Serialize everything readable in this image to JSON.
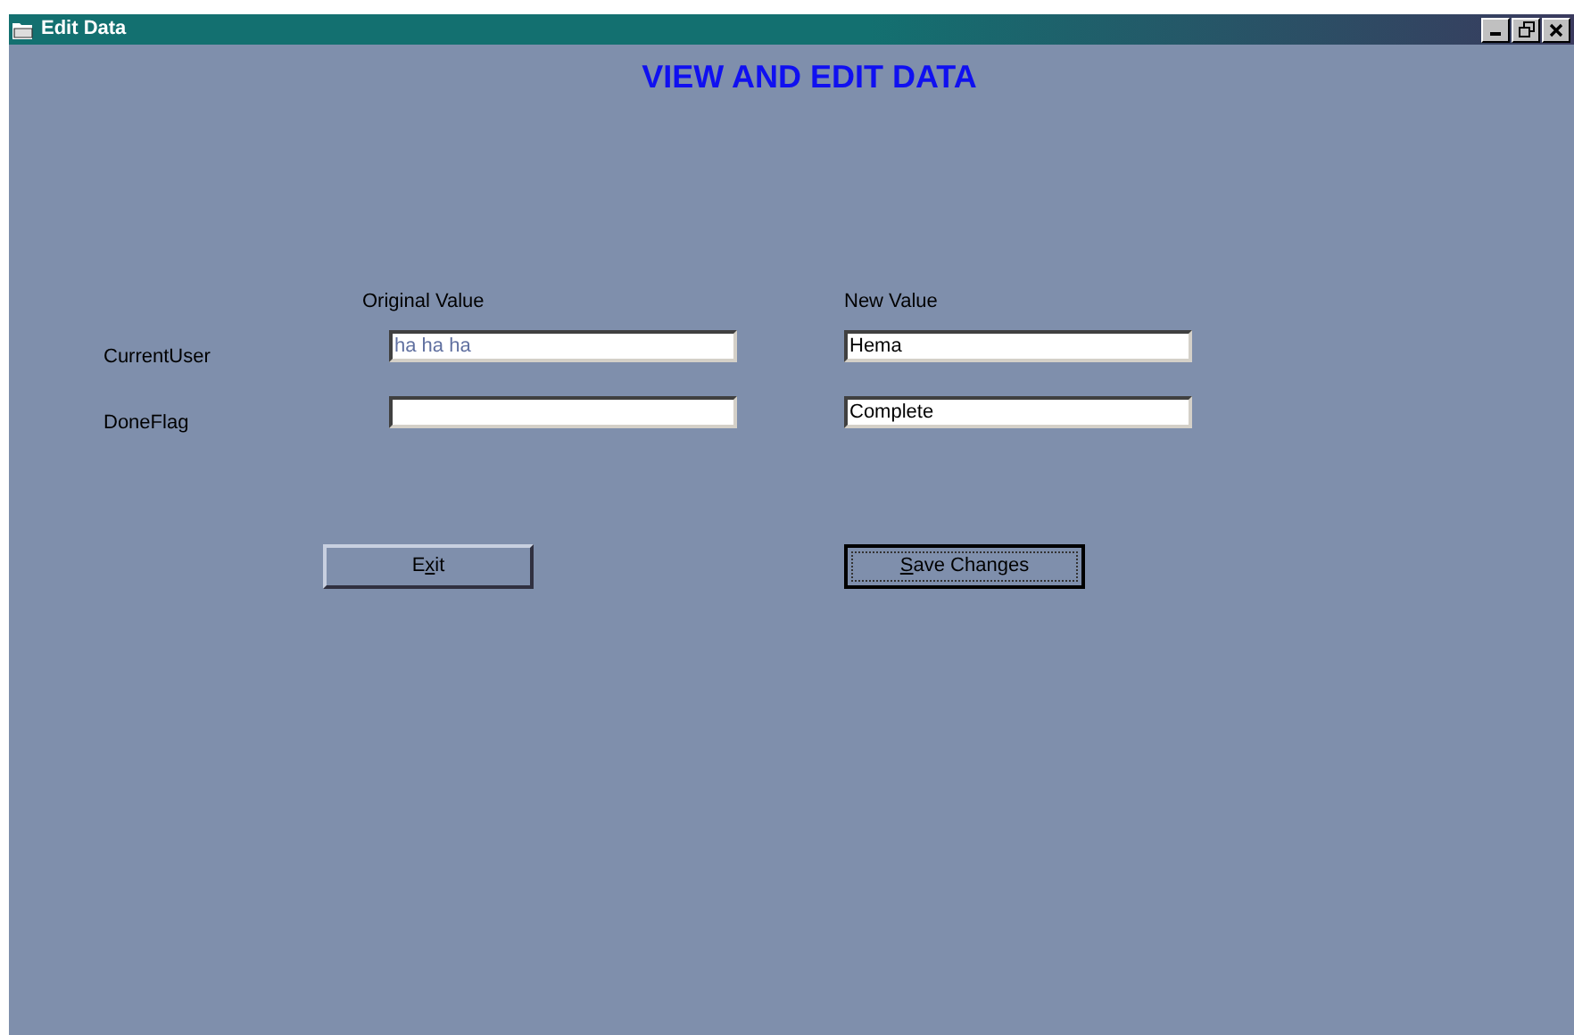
{
  "window": {
    "title": "Edit Data"
  },
  "heading": "VIEW AND EDIT DATA",
  "columns": [
    "Original Value",
    "New Value"
  ],
  "rows": [
    {
      "label": "CurrentUser",
      "original": {
        "value": "ha ha ha",
        "disabled": true
      },
      "new": {
        "value": "Hema",
        "disabled": false
      }
    },
    {
      "label": "DoneFlag",
      "original": {},
      "new": {
        "value": "Complete",
        "disabled": false
      }
    }
  ],
  "buttons": [
    {
      "before": "E",
      "key": "x",
      "after": "it",
      "focused": false
    },
    {
      "key": "S",
      "after": "ave Changes",
      "focused": true
    }
  ]
}
